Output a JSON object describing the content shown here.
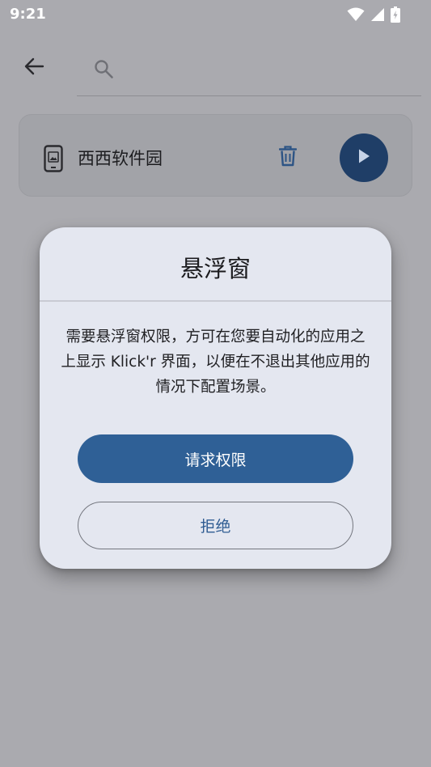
{
  "status_bar": {
    "time": "9:21",
    "icons": [
      "wifi-icon",
      "signal-icon",
      "battery-charging-icon"
    ]
  },
  "top_bar": {
    "back_icon": "arrow-left-icon",
    "search": {
      "icon": "search-icon",
      "placeholder": "",
      "value": ""
    }
  },
  "app_card": {
    "app_name": "西西软件园",
    "icons": [
      "smartphone-icon",
      "trash-icon",
      "play-icon"
    ]
  },
  "dialog": {
    "title": "悬浮窗",
    "message": "需要悬浮窗权限，方可在您要自动化的应用之上显示 Klick'r 界面，以便在不退出其他应用的情况下配置场景。",
    "primary_button": "请求权限",
    "secondary_button": "拒绝"
  },
  "colors": {
    "scrim_background": "#aaaaaf",
    "dialog_background": "#e4e7f0",
    "primary": "#2f6096",
    "play_button": "#1f3e67",
    "delete_icon": "#2d5485"
  }
}
